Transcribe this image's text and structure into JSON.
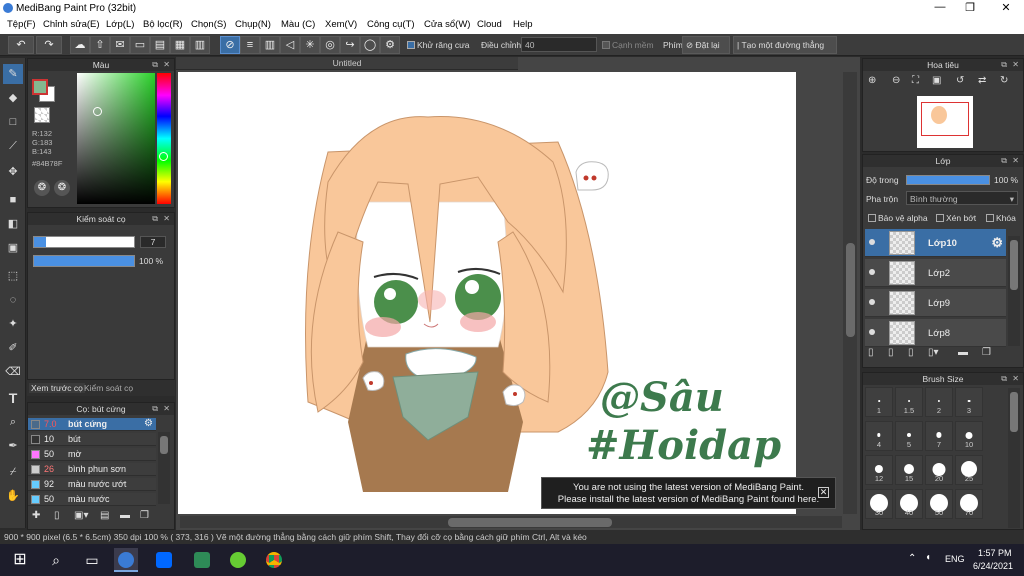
{
  "window": {
    "title": "MediBang Paint Pro (32bit)",
    "controls": [
      "—",
      "❐",
      "✕"
    ]
  },
  "menu": [
    "Tệp(F)",
    "Chỉnh sửa(E)",
    "Lớp(L)",
    "Bộ lọc(R)",
    "Chọn(S)",
    "Chụp(N)",
    "Màu (C)",
    "Xem(V)",
    "Công cụ(T)",
    "Cửa sổ(W)",
    "Cloud",
    "Help"
  ],
  "toolbar": {
    "anti_alias_label": "Khử răng cưa",
    "adjust_label": "Điều chỉnh",
    "adjust_value": "40",
    "edge_label": "Cạnh mềm",
    "key_label": "Phím",
    "reset_label": "Đặt lại",
    "straight_label": "Tạo một đường thẳng"
  },
  "color_panel": {
    "title": "Màu",
    "r": "R:132",
    "g": "G:183",
    "b": "B:143",
    "hex": "#84B78F",
    "fg_color": "#84b78f",
    "bg_color": "#ffffff"
  },
  "brush_control": {
    "title": "Kiểm soát cọ",
    "size": "7",
    "opacity": "100 %"
  },
  "tabs": {
    "preview": "Xem trước cọ",
    "control": "Kiểm soát cọ"
  },
  "brush_list": {
    "title": "Cọ: bút cứng",
    "items": [
      {
        "size": "7.0",
        "name": "bút cứng",
        "color": "#4a6a8a"
      },
      {
        "size": "10",
        "name": "bút",
        "color": "#333333"
      },
      {
        "size": "50",
        "name": "mờ",
        "color": "#ff77ff"
      },
      {
        "size": "26",
        "name": "bình phun sơn",
        "color": "#cccccc"
      },
      {
        "size": "92",
        "name": "màu nước ướt",
        "color": "#66ccff"
      },
      {
        "size": "50",
        "name": "màu nước",
        "color": "#66ccff"
      }
    ]
  },
  "document": {
    "tab": "Untitled",
    "signature_1": "@Sâu",
    "signature_2": "#Hoidap"
  },
  "notification": {
    "line1": "You are not using the latest version of MediBang Paint.",
    "line2": "Please install the latest version of MediBang Paint found here."
  },
  "navigator": {
    "title": "Hoa tiêu"
  },
  "layers": {
    "title": "Lớp",
    "opacity_label": "Độ trong",
    "opacity_value": "100 %",
    "blend_label": "Pha trộn",
    "blend_value": "Bình thường",
    "protect_alpha": "Bảo vệ alpha",
    "clipping": "Xén bớt",
    "lock": "Khóa",
    "items": [
      {
        "name": "Lớp10"
      },
      {
        "name": "Lớp2"
      },
      {
        "name": "Lớp9"
      },
      {
        "name": "Lớp8"
      }
    ]
  },
  "brush_size": {
    "title": "Brush Size",
    "sizes": [
      "1",
      "1.5",
      "2",
      "3",
      "4",
      "5",
      "7",
      "10",
      "12",
      "15",
      "20",
      "25",
      "30",
      "40",
      "50",
      "70"
    ]
  },
  "status": "900 * 900 pixel   (6.5 * 6.5cm)   350 dpi   100 %   ( 373, 316 )   Vẽ một đường thẳng bằng cách giữ phím Shift, Thay đổi cỡ cọ bằng cách giữ phím Ctrl, Alt và kéo",
  "taskbar": {
    "lang": "ENG",
    "time": "1:57 PM",
    "date": "6/24/2021"
  }
}
